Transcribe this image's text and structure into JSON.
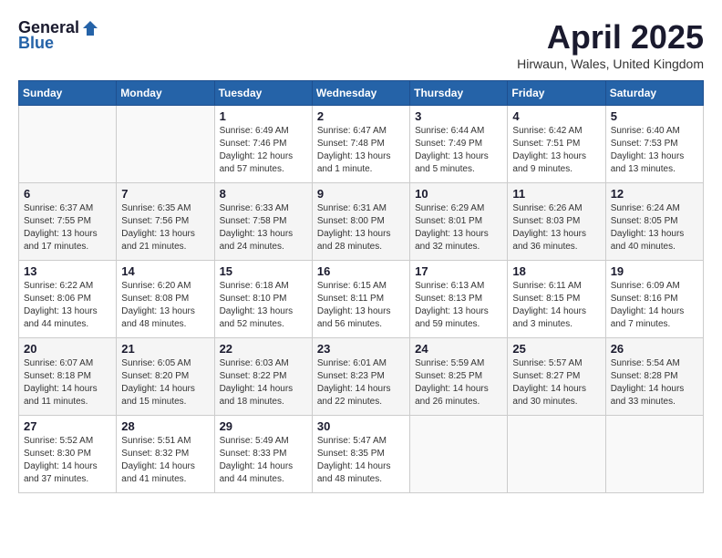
{
  "logo": {
    "general": "General",
    "blue": "Blue"
  },
  "title": "April 2025",
  "location": "Hirwaun, Wales, United Kingdom",
  "days_header": [
    "Sunday",
    "Monday",
    "Tuesday",
    "Wednesday",
    "Thursday",
    "Friday",
    "Saturday"
  ],
  "weeks": [
    [
      {
        "day": "",
        "info": ""
      },
      {
        "day": "",
        "info": ""
      },
      {
        "day": "1",
        "info": "Sunrise: 6:49 AM\nSunset: 7:46 PM\nDaylight: 12 hours and 57 minutes."
      },
      {
        "day": "2",
        "info": "Sunrise: 6:47 AM\nSunset: 7:48 PM\nDaylight: 13 hours and 1 minute."
      },
      {
        "day": "3",
        "info": "Sunrise: 6:44 AM\nSunset: 7:49 PM\nDaylight: 13 hours and 5 minutes."
      },
      {
        "day": "4",
        "info": "Sunrise: 6:42 AM\nSunset: 7:51 PM\nDaylight: 13 hours and 9 minutes."
      },
      {
        "day": "5",
        "info": "Sunrise: 6:40 AM\nSunset: 7:53 PM\nDaylight: 13 hours and 13 minutes."
      }
    ],
    [
      {
        "day": "6",
        "info": "Sunrise: 6:37 AM\nSunset: 7:55 PM\nDaylight: 13 hours and 17 minutes."
      },
      {
        "day": "7",
        "info": "Sunrise: 6:35 AM\nSunset: 7:56 PM\nDaylight: 13 hours and 21 minutes."
      },
      {
        "day": "8",
        "info": "Sunrise: 6:33 AM\nSunset: 7:58 PM\nDaylight: 13 hours and 24 minutes."
      },
      {
        "day": "9",
        "info": "Sunrise: 6:31 AM\nSunset: 8:00 PM\nDaylight: 13 hours and 28 minutes."
      },
      {
        "day": "10",
        "info": "Sunrise: 6:29 AM\nSunset: 8:01 PM\nDaylight: 13 hours and 32 minutes."
      },
      {
        "day": "11",
        "info": "Sunrise: 6:26 AM\nSunset: 8:03 PM\nDaylight: 13 hours and 36 minutes."
      },
      {
        "day": "12",
        "info": "Sunrise: 6:24 AM\nSunset: 8:05 PM\nDaylight: 13 hours and 40 minutes."
      }
    ],
    [
      {
        "day": "13",
        "info": "Sunrise: 6:22 AM\nSunset: 8:06 PM\nDaylight: 13 hours and 44 minutes."
      },
      {
        "day": "14",
        "info": "Sunrise: 6:20 AM\nSunset: 8:08 PM\nDaylight: 13 hours and 48 minutes."
      },
      {
        "day": "15",
        "info": "Sunrise: 6:18 AM\nSunset: 8:10 PM\nDaylight: 13 hours and 52 minutes."
      },
      {
        "day": "16",
        "info": "Sunrise: 6:15 AM\nSunset: 8:11 PM\nDaylight: 13 hours and 56 minutes."
      },
      {
        "day": "17",
        "info": "Sunrise: 6:13 AM\nSunset: 8:13 PM\nDaylight: 13 hours and 59 minutes."
      },
      {
        "day": "18",
        "info": "Sunrise: 6:11 AM\nSunset: 8:15 PM\nDaylight: 14 hours and 3 minutes."
      },
      {
        "day": "19",
        "info": "Sunrise: 6:09 AM\nSunset: 8:16 PM\nDaylight: 14 hours and 7 minutes."
      }
    ],
    [
      {
        "day": "20",
        "info": "Sunrise: 6:07 AM\nSunset: 8:18 PM\nDaylight: 14 hours and 11 minutes."
      },
      {
        "day": "21",
        "info": "Sunrise: 6:05 AM\nSunset: 8:20 PM\nDaylight: 14 hours and 15 minutes."
      },
      {
        "day": "22",
        "info": "Sunrise: 6:03 AM\nSunset: 8:22 PM\nDaylight: 14 hours and 18 minutes."
      },
      {
        "day": "23",
        "info": "Sunrise: 6:01 AM\nSunset: 8:23 PM\nDaylight: 14 hours and 22 minutes."
      },
      {
        "day": "24",
        "info": "Sunrise: 5:59 AM\nSunset: 8:25 PM\nDaylight: 14 hours and 26 minutes."
      },
      {
        "day": "25",
        "info": "Sunrise: 5:57 AM\nSunset: 8:27 PM\nDaylight: 14 hours and 30 minutes."
      },
      {
        "day": "26",
        "info": "Sunrise: 5:54 AM\nSunset: 8:28 PM\nDaylight: 14 hours and 33 minutes."
      }
    ],
    [
      {
        "day": "27",
        "info": "Sunrise: 5:52 AM\nSunset: 8:30 PM\nDaylight: 14 hours and 37 minutes."
      },
      {
        "day": "28",
        "info": "Sunrise: 5:51 AM\nSunset: 8:32 PM\nDaylight: 14 hours and 41 minutes."
      },
      {
        "day": "29",
        "info": "Sunrise: 5:49 AM\nSunset: 8:33 PM\nDaylight: 14 hours and 44 minutes."
      },
      {
        "day": "30",
        "info": "Sunrise: 5:47 AM\nSunset: 8:35 PM\nDaylight: 14 hours and 48 minutes."
      },
      {
        "day": "",
        "info": ""
      },
      {
        "day": "",
        "info": ""
      },
      {
        "day": "",
        "info": ""
      }
    ]
  ]
}
